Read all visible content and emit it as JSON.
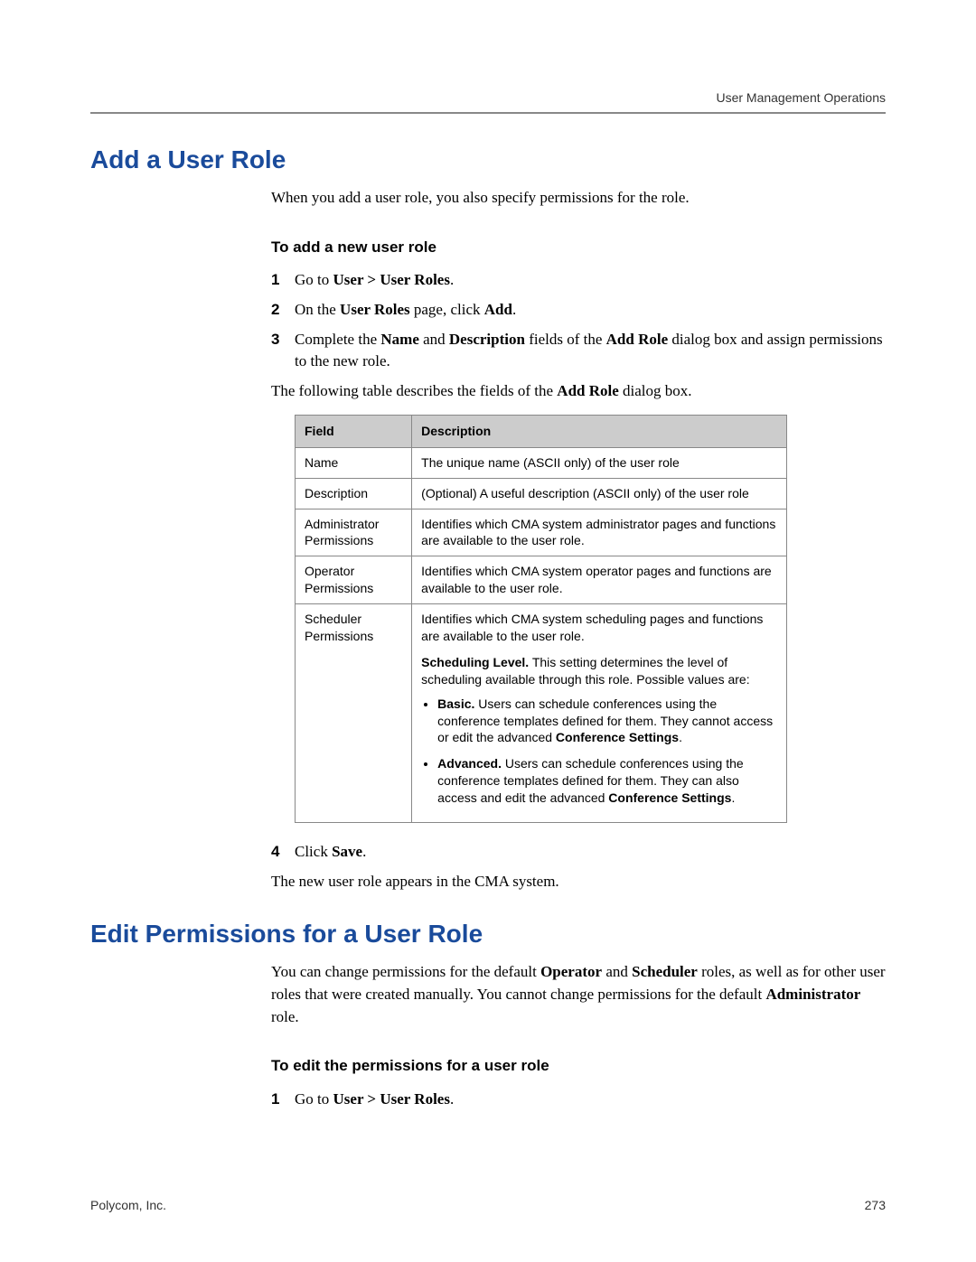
{
  "header": {
    "label": "User Management Operations"
  },
  "section1": {
    "title": "Add a User Role",
    "intro": "When you add a user role, you also specify permissions for the role.",
    "subhead": "To add a new user role",
    "step1": {
      "num": "1",
      "pre": "Go to ",
      "b1": "User > User Roles",
      "post": "."
    },
    "step2": {
      "num": "2",
      "pre": "On the ",
      "b1": "User Roles",
      "mid": " page, click ",
      "b2": "Add",
      "post": "."
    },
    "step3": {
      "num": "3",
      "pre": "Complete the ",
      "b1": "Name",
      "mid1": " and ",
      "b2": "Description",
      "mid2": " fields of the ",
      "b3": "Add Role",
      "post": " dialog box and assign permissions to the new role."
    },
    "step3_para": {
      "pre": "The following table describes the fields of the ",
      "b1": "Add Role",
      "post": " dialog box."
    },
    "table": {
      "headers": {
        "col1": "Field",
        "col2": "Description"
      },
      "rows": [
        {
          "field": "Name",
          "desc": "The unique name (ASCII only) of the user role"
        },
        {
          "field": "Description",
          "desc": "(Optional) A useful description (ASCII only) of the user role"
        },
        {
          "field": "Administrator Permissions",
          "desc": "Identifies which CMA system administrator pages and functions are available to the user role."
        },
        {
          "field": "Operator Permissions",
          "desc": "Identifies which CMA system operator pages and functions are available to the user role."
        }
      ],
      "row5": {
        "field": "Scheduler Permissions",
        "p1": "Identifies which CMA system scheduling pages and functions are available to the user role.",
        "p2_b": "Scheduling Level.",
        "p2": " This setting determines the level of scheduling available through this role. Possible values are:",
        "bullet1_b": "Basic.",
        "bullet1": " Users can schedule conferences using the conference templates defined for them. They cannot access or edit the advanced ",
        "bullet1_b2": "Conference Settings",
        "bullet1_post": ".",
        "bullet2_b": "Advanced.",
        "bullet2": " Users can schedule conferences using the conference templates defined for them. They can also access and edit the advanced ",
        "bullet2_b2": "Conference Settings",
        "bullet2_post": "."
      }
    },
    "step4": {
      "num": "4",
      "pre": "Click ",
      "b1": "Save",
      "post": "."
    },
    "step4_para": "The new user role appears in the CMA system."
  },
  "section2": {
    "title": "Edit Permissions for a User Role",
    "intro_pre": "You can change permissions for the default ",
    "intro_b1": "Operator",
    "intro_mid1": " and ",
    "intro_b2": "Scheduler",
    "intro_mid2": " roles, as well as for other user roles that were created manually. You cannot change permissions for the default ",
    "intro_b3": "Administrator",
    "intro_post": " role.",
    "subhead": "To edit the permissions for a user role",
    "step1": {
      "num": "1",
      "pre": "Go to ",
      "b1": "User > User Roles",
      "post": "."
    }
  },
  "footer": {
    "left": "Polycom, Inc.",
    "right": "273"
  }
}
